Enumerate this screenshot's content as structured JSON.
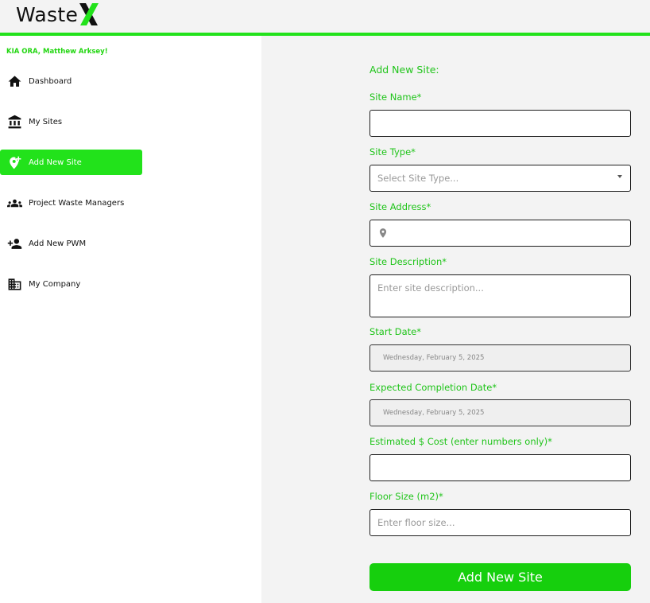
{
  "brand": {
    "name": "Waste",
    "accent": "#22e21b"
  },
  "sidebar": {
    "greeting": "KIA ORA, Matthew Arksey!",
    "items": [
      {
        "label": "Dashboard",
        "icon": "home-icon"
      },
      {
        "label": "My Sites",
        "icon": "bank-icon"
      },
      {
        "label": "Add New Site",
        "icon": "add-location-icon",
        "active": true
      },
      {
        "label": "Project Waste Managers",
        "icon": "group-icon"
      },
      {
        "label": "Add New PWM",
        "icon": "person-add-icon"
      },
      {
        "label": "My Company",
        "icon": "building-icon"
      }
    ]
  },
  "form": {
    "title": "Add New Site:",
    "site_name": {
      "label": "Site Name*",
      "value": ""
    },
    "site_type": {
      "label": "Site Type*",
      "placeholder": "Select Site Type..."
    },
    "site_address": {
      "label": "Site Address*",
      "value": ""
    },
    "site_description": {
      "label": "Site Description*",
      "placeholder": "Enter site description..."
    },
    "start_date": {
      "label": "Start Date*",
      "value": "Wednesday, February 5, 2025"
    },
    "completion_date": {
      "label": "Expected Completion Date*",
      "value": "Wednesday, February 5, 2025"
    },
    "cost": {
      "label": "Estimated $ Cost (enter numbers only)*",
      "value": ""
    },
    "floor_size": {
      "label": "Floor Size (m2)*",
      "placeholder": "Enter floor size..."
    },
    "submit_label": "Add New Site"
  }
}
